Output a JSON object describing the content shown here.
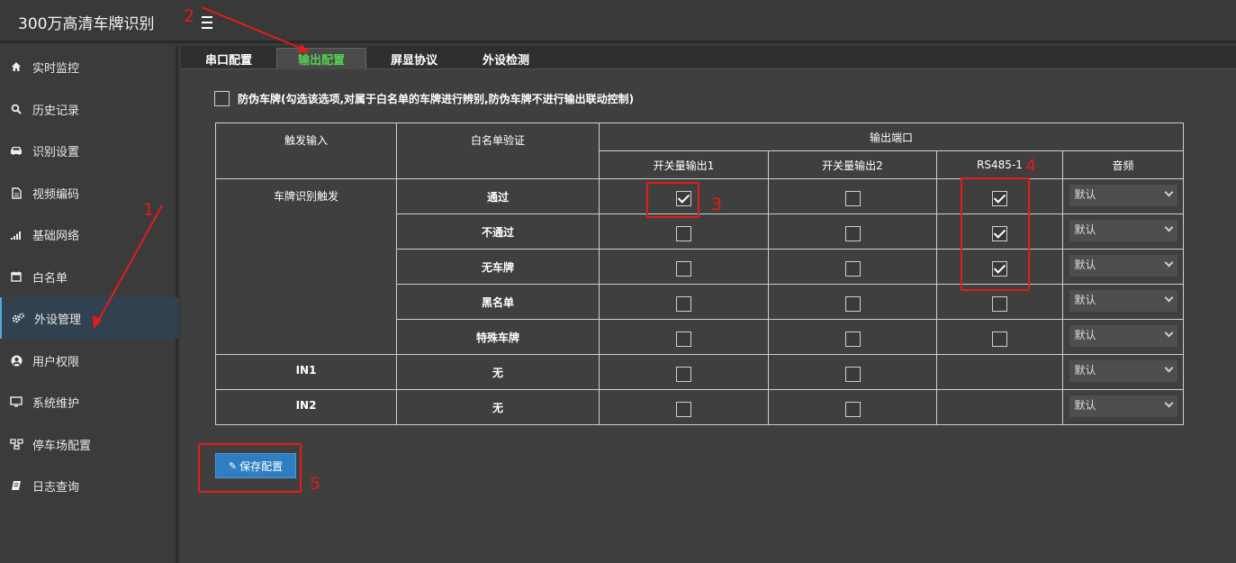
{
  "app": {
    "title": "300万高清车牌识别"
  },
  "sidebar": {
    "items": [
      {
        "label": "实时监控",
        "icon": "home-icon"
      },
      {
        "label": "历史记录",
        "icon": "search-icon"
      },
      {
        "label": "识别设置",
        "icon": "car-icon"
      },
      {
        "label": "视频编码",
        "icon": "file-icon"
      },
      {
        "label": "基础网络",
        "icon": "signal-icon"
      },
      {
        "label": "白名单",
        "icon": "calendar-icon"
      },
      {
        "label": "外设管理",
        "icon": "gears-icon",
        "active": true
      },
      {
        "label": "用户权限",
        "icon": "user-icon"
      },
      {
        "label": "系统维护",
        "icon": "monitor-icon"
      },
      {
        "label": "停车场配置",
        "icon": "sitemap-icon"
      },
      {
        "label": "日志查询",
        "icon": "book-icon"
      }
    ]
  },
  "tabs": [
    {
      "label": "串口配置"
    },
    {
      "label": "输出配置",
      "active": true
    },
    {
      "label": "屏显协议"
    },
    {
      "label": "外设检测"
    }
  ],
  "anti_fake": {
    "label": "防伪车牌(勾选该选项,对属于白名单的车牌进行辨别,防伪车牌不进行输出联动控制)",
    "checked": false
  },
  "table": {
    "headers": {
      "trigger": "触发输入",
      "whitelist": "白名单验证",
      "output": "输出端口",
      "switch1": "开关量输出1",
      "switch2": "开关量输出2",
      "rs485": "RS485-1",
      "audio": "音频"
    },
    "plate_trigger": "车牌识别触发",
    "rows": [
      {
        "verify": "通过",
        "sw1": true,
        "sw2": false,
        "rs485": true,
        "audio": "默认"
      },
      {
        "verify": "不通过",
        "sw1": false,
        "sw2": false,
        "rs485": true,
        "audio": "默认"
      },
      {
        "verify": "无车牌",
        "sw1": false,
        "sw2": false,
        "rs485": true,
        "audio": "默认"
      },
      {
        "verify": "黑名单",
        "sw1": false,
        "sw2": false,
        "rs485": false,
        "audio": "默认"
      },
      {
        "verify": "特殊车牌",
        "sw1": false,
        "sw2": false,
        "rs485": false,
        "audio": "默认"
      },
      {
        "trigger": "IN1",
        "verify": "无",
        "sw1": false,
        "sw2": false,
        "audio": "默认"
      },
      {
        "trigger": "IN2",
        "verify": "无",
        "sw1": false,
        "sw2": false,
        "audio": "默认"
      }
    ]
  },
  "save_button": {
    "label": "保存配置"
  },
  "annotations": {
    "colors": {
      "annotation": "#e31b1b",
      "active_tab": "#54d14f",
      "button": "#2f7ec1"
    },
    "numbers": [
      "1",
      "2",
      "3",
      "4",
      "5"
    ]
  }
}
